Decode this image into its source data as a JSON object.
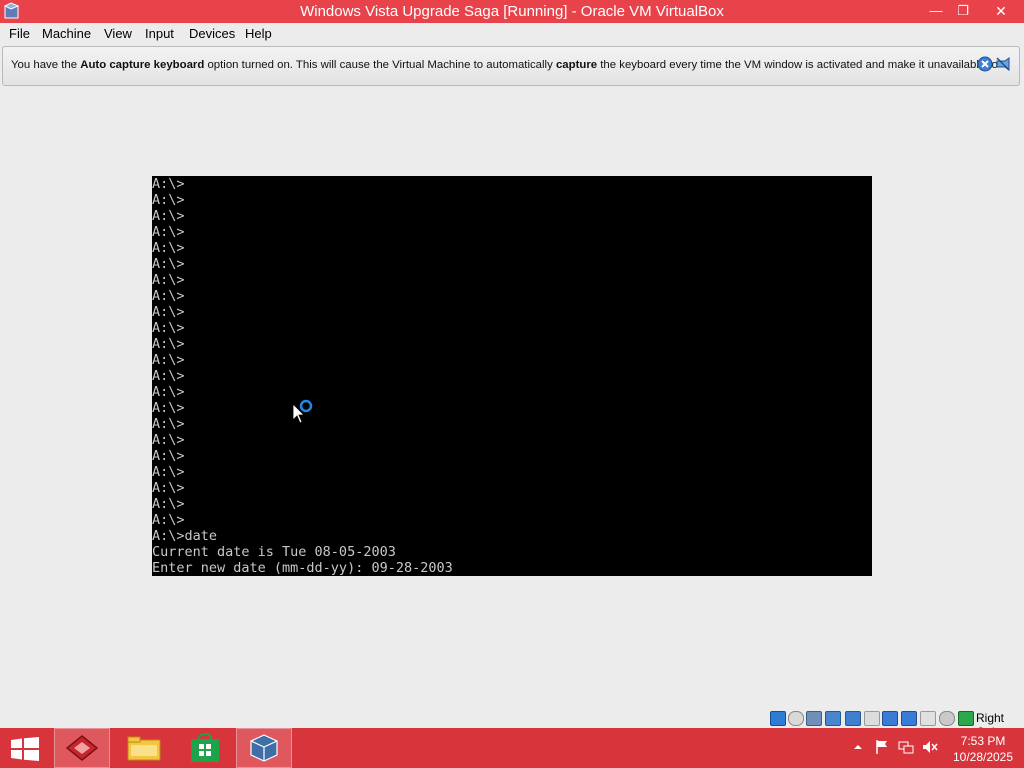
{
  "window": {
    "title": "Windows Vista Upgrade Saga [Running] - Oracle VM VirtualBox",
    "controls": {
      "minimize": "—",
      "restore": "❐",
      "close": "✕"
    }
  },
  "menu": {
    "items": [
      {
        "label": "File"
      },
      {
        "label": "Machine"
      },
      {
        "label": "View"
      },
      {
        "label": "Input"
      },
      {
        "label": "Devices"
      },
      {
        "label": "Help"
      }
    ]
  },
  "banner": {
    "part1": "You have the ",
    "bold1": "Auto capture keyboard",
    "part2": " option turned on. This will cause the Virtual Machine to automatically ",
    "bold2": "capture",
    "part3": " the keyboard every time the VM window is activated and make it unavailable to",
    "icons": [
      "close-message-icon",
      "do-not-show-again-icon"
    ]
  },
  "console": {
    "text": "A:\\>\nA:\\>\nA:\\>\nA:\\>\nA:\\>\nA:\\>\nA:\\>\nA:\\>\nA:\\>\nA:\\>\nA:\\>\nA:\\>\nA:\\>\nA:\\>\nA:\\>\nA:\\>\nA:\\>\nA:\\>\nA:\\>\nA:\\>\nA:\\>\nA:\\>\nA:\\>date\nCurrent date is Tue 08-05-2003\nEnter new date (mm-dd-yy): 09-28-2003"
  },
  "statusbar": {
    "icons": [
      "hard-disk-icon",
      "optical-drive-icon",
      "audio-icon",
      "network-icon",
      "usb-icon",
      "shared-folders-icon",
      "display-icon",
      "video-capture-icon",
      "mouse-integration-icon",
      "keyboard-capture-icon",
      "cpu-icon",
      "host-key-icon"
    ],
    "host_key": "Right Ctrl"
  },
  "taskbar": {
    "apps": [
      "start-icon",
      "parallels-icon",
      "file-explorer-icon",
      "store-icon",
      "virtualbox-icon"
    ],
    "tray": [
      "show-hidden-icons",
      "action-center-flag-icon",
      "network-icon",
      "volume-muted-icon"
    ],
    "time": "7:53 PM",
    "date": "10/28/2025"
  },
  "colors": {
    "titlebar": "#e8434b",
    "taskbar": "#d7343b",
    "vm_background": "#000000",
    "console_text": "#c8c8c8"
  }
}
